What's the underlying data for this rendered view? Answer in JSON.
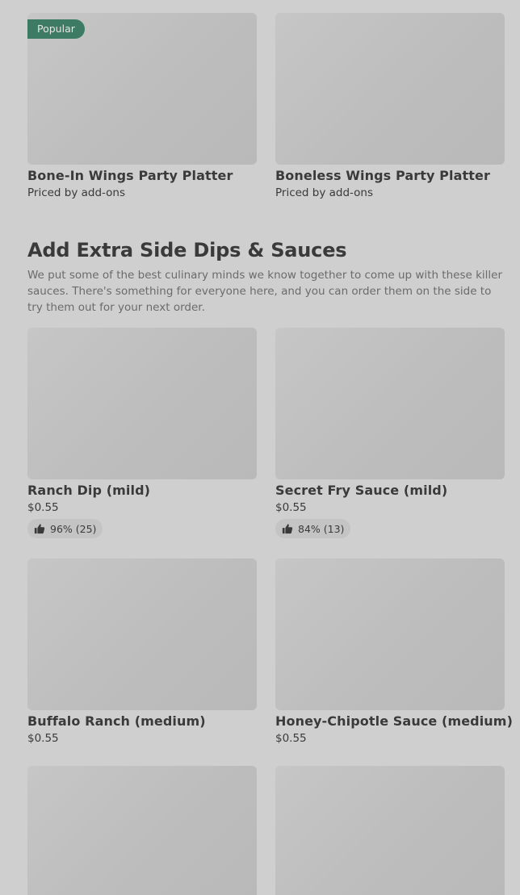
{
  "top_row": [
    {
      "badge": "Popular",
      "title": "Bone-In Wings Party Platter",
      "price": "Priced by add-ons"
    },
    {
      "badge": "",
      "title": "Boneless Wings Party Platter",
      "price": "Priced by add-ons"
    }
  ],
  "section": {
    "title": "Add Extra Side Dips & Sauces",
    "description": "We put some of the best culinary minds we know together to come up with these killer sauces. There's something for everyone here, and you can order them on the side to try them out for your next order."
  },
  "items": [
    {
      "title": "Ranch Dip (mild)",
      "price": "$0.55",
      "rating": "96% (25)"
    },
    {
      "title": "Secret Fry Sauce (mild)",
      "price": "$0.55",
      "rating": "84% (13)"
    },
    {
      "title": "Buffalo Ranch (medium)",
      "price": "$0.55",
      "rating": ""
    },
    {
      "title": "Honey-Chipotle Sauce (medium)",
      "price": "$0.55",
      "rating": ""
    }
  ],
  "icons": {
    "thumbs_up": "thumbs-up-icon"
  },
  "colors": {
    "background": "#cfcfcf",
    "badge_bg": "#3e7b64",
    "thumb_bg": "#c6c6c6"
  }
}
